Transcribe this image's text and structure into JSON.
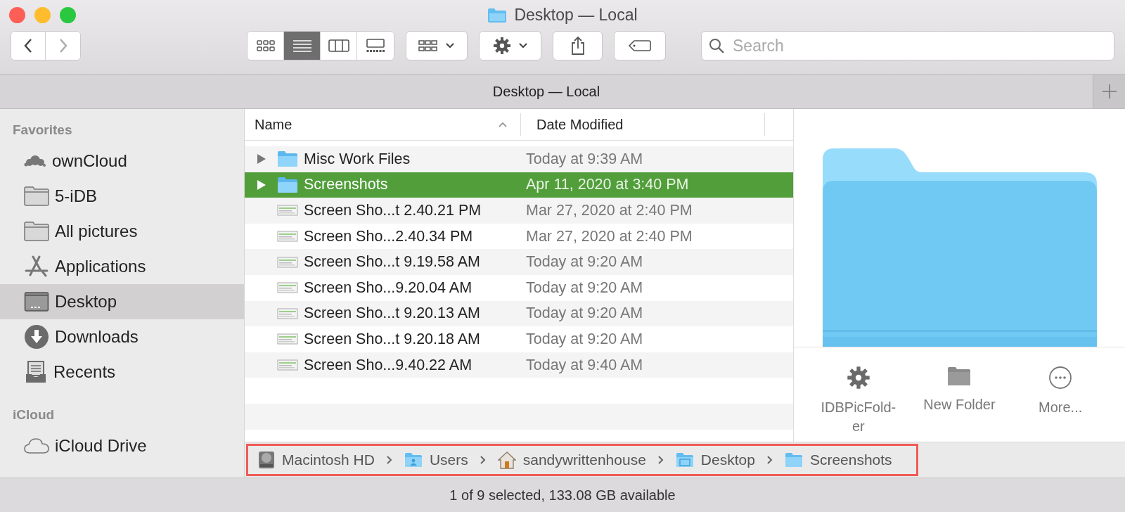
{
  "window": {
    "title": "Desktop — Local"
  },
  "toolbar": {
    "views": [
      {
        "kind": "icons",
        "selected": false
      },
      {
        "kind": "list",
        "selected": true
      },
      {
        "kind": "columns",
        "selected": false
      },
      {
        "kind": "gallery",
        "selected": false
      }
    ],
    "search": {
      "placeholder": "Search"
    }
  },
  "tab_bar": {
    "title": "Desktop — Local"
  },
  "sidebar": {
    "sections": [
      {
        "title": "Favorites",
        "items": [
          {
            "label": "ownCloud",
            "kind": "cluster",
            "selected": false
          },
          {
            "label": "5-iDB",
            "kind": "folder",
            "selected": false
          },
          {
            "label": "All pictures",
            "kind": "folder",
            "selected": false
          },
          {
            "label": "Applications",
            "kind": "apps",
            "selected": false
          },
          {
            "label": "Desktop",
            "kind": "desktop",
            "selected": true
          },
          {
            "label": "Downloads",
            "kind": "download",
            "selected": false
          },
          {
            "label": "Recents",
            "kind": "tray",
            "selected": false
          }
        ]
      },
      {
        "title": "iCloud",
        "items": [
          {
            "label": "iCloud Drive",
            "kind": "cloud",
            "selected": false
          }
        ]
      }
    ]
  },
  "table": {
    "columns": [
      "Name",
      "Date Modified"
    ],
    "rows": [
      {
        "name": "Misc Work Files",
        "date": "Today at 9:39 AM",
        "kind": "folder",
        "selected": false
      },
      {
        "name": "Screenshots",
        "date": "Apr 11, 2020 at 3:40 PM",
        "kind": "folder",
        "selected": true
      },
      {
        "name": "Screen Sho...t 2.40.21 PM",
        "date": "Mar 27, 2020 at 2:40 PM",
        "kind": "image",
        "selected": false
      },
      {
        "name": "Screen Sho...2.40.34 PM",
        "date": "Mar 27, 2020 at 2:40 PM",
        "kind": "image",
        "selected": false
      },
      {
        "name": "Screen Sho...t 9.19.58 AM",
        "date": "Today at 9:20 AM",
        "kind": "image",
        "selected": false
      },
      {
        "name": "Screen Sho...9.20.04 AM",
        "date": "Today at 9:20 AM",
        "kind": "image",
        "selected": false
      },
      {
        "name": "Screen Sho...t 9.20.13 AM",
        "date": "Today at 9:20 AM",
        "kind": "image",
        "selected": false
      },
      {
        "name": "Screen Sho...t 9.20.18 AM",
        "date": "Today at 9:20 AM",
        "kind": "image",
        "selected": false
      },
      {
        "name": "Screen Sho...9.40.22 AM",
        "date": "Today at 9:40 AM",
        "kind": "image",
        "selected": false
      }
    ]
  },
  "preview": {
    "actions": [
      {
        "label": "IDBPicFold-\ner",
        "kind": "gear"
      },
      {
        "label": "New Folder",
        "kind": "folder"
      },
      {
        "label": "More...",
        "kind": "more"
      }
    ]
  },
  "path_bar": {
    "items": [
      {
        "label": "Macintosh HD",
        "kind": "disk"
      },
      {
        "label": "Users",
        "kind": "users"
      },
      {
        "label": "sandywrittenhouse",
        "kind": "home"
      },
      {
        "label": "Desktop",
        "kind": "desktop"
      },
      {
        "label": "Screenshots",
        "kind": "folder"
      }
    ]
  },
  "status_bar": {
    "text": "1 of 9 selected, 133.08 GB available"
  }
}
